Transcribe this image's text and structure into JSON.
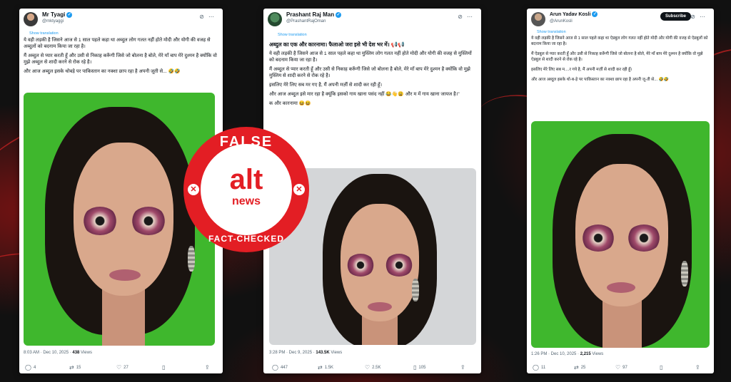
{
  "tweets": [
    {
      "name": "Mr Tyagi",
      "handle": "@mktyaggi",
      "show_translation": "Show translation",
      "paragraphs": [
        "ये वही लड़की है जिसने आज से 1 साल पहले कहा था अब्दुल लोग गलत नहीं होते मोदी और योगी की वजह से अब्दुलों को बदनाम किया जा रहा है।",
        "मैं अब्दुल से प्यार करती हूँ और उसी से निकाह करूँगी जिसे जो बोलना है बोले, मेरे माँ बाप मेरे दुश्मन है क्योंकि वो मुझे अब्दुल से शादी करने से रोक रहे है।",
        "और आज अब्दुल इसके थोबड़े पर पाकिस्तान का नक्शा छाप रहा है अपनी जूती से... 🤣🤣"
      ],
      "time": "8:03 AM · Dec 10, 2025 · ",
      "views": "438",
      "views_label": " Views",
      "replies": "4",
      "reposts": "15",
      "likes": "27",
      "bookmarks": "",
      "share": ""
    },
    {
      "name": "Prashant Raj Man",
      "handle": "@PrashantRajOman",
      "show_translation": "Show translation",
      "headline": "अब्दुल का एक और कारनामा। फैलाओ जरा इसे भी देश भर में। 📢📢",
      "paragraphs": [
        "ये वही लड़की है जिसने आज से 1 साल पहले कहा था मुस्लिम लोग गलत नहीं होते मोदी और योगी की वजह से मुस्लिमों को बदनाम किया जा रहा है।",
        "मैं अब्दुल से प्यार करती हूँ और उसी से निकाह करूँगी जिसे जो बोलना है बोले, मेरे माँ बाप मेरे दुश्मन है क्योंकि वो मुझे मुस्लिम से शादी करने से रोक रहे है।",
        "इसलिए मेरे लिए सब मर गए है, मैं अपनी मर्ज़ी से शादी कर रही हूँ।",
        "और आज अब्दुल इसे मार रहा है क्यूंकि इसको गाय खाना पसंद नहीं 😂👋😩 और म में गाय खाना जायज है।\"",
        "क और कारनामा 😆😆"
      ],
      "time": "3:28 PM · Dec 9, 2025 · ",
      "views": "143.5K",
      "views_label": " Views",
      "replies": "447",
      "reposts": "1.5K",
      "likes": "2.5K",
      "bookmarks": "105",
      "share": ""
    },
    {
      "name": "Arun Yadav Kosli",
      "handle": "@ArunKosli",
      "subscribe": "Subscribe",
      "show_translation": "Show translation",
      "paragraphs": [
        "ये वही लड़की है जिसने आज से 1 साल पहले कहा था ऐडबुल लोग गलत नहीं होते मोदी और योगी की वजह से ऐडबुलों को बदनाम किया जा रहा है।",
        "मैं ऐडबुल से प्यार करती हूँ और उसी से निकाह करूँगी जिसे जो बोलना है बोले, मेरे माँ बाप मेरे दुश्मन है क्योंकि वो मुझे ऐडबुल से शादी करने से रोक रहे है।",
        "इसलिए मेरे लिए सब म....र गये है, मैं अपनी मर्ज़ी से शादी कर रही हूँ।",
        "और आज अब्दुल इसके थो-ब-ड़े पर पाकिस्तान का नक्शा छाप रहा है अपनी जू-ती से... 🤣🤣"
      ],
      "time": "1:26 PM · Dec 10, 2025 · ",
      "views": "2,215",
      "views_label": " Views",
      "replies": "11",
      "reposts": "25",
      "likes": "97",
      "bookmarks": "",
      "share": ""
    }
  ],
  "stamp": {
    "top": "FALSE",
    "logo": "alt",
    "logo_sub": "news",
    "bottom": "FACT-CHECKED",
    "colors": {
      "red": "#e31e24",
      "white": "#ffffff"
    }
  },
  "icons": {
    "reply": "speech-bubble-icon",
    "repost": "repost-icon",
    "like": "heart-icon",
    "bookmark": "bookmark-icon",
    "share": "share-icon",
    "grok": "grok-icon",
    "more": "more-icon"
  },
  "colors": {
    "twitter_blue": "#1d9bf0",
    "background_red": "#c81414",
    "green_screen": "#3fb72d"
  }
}
